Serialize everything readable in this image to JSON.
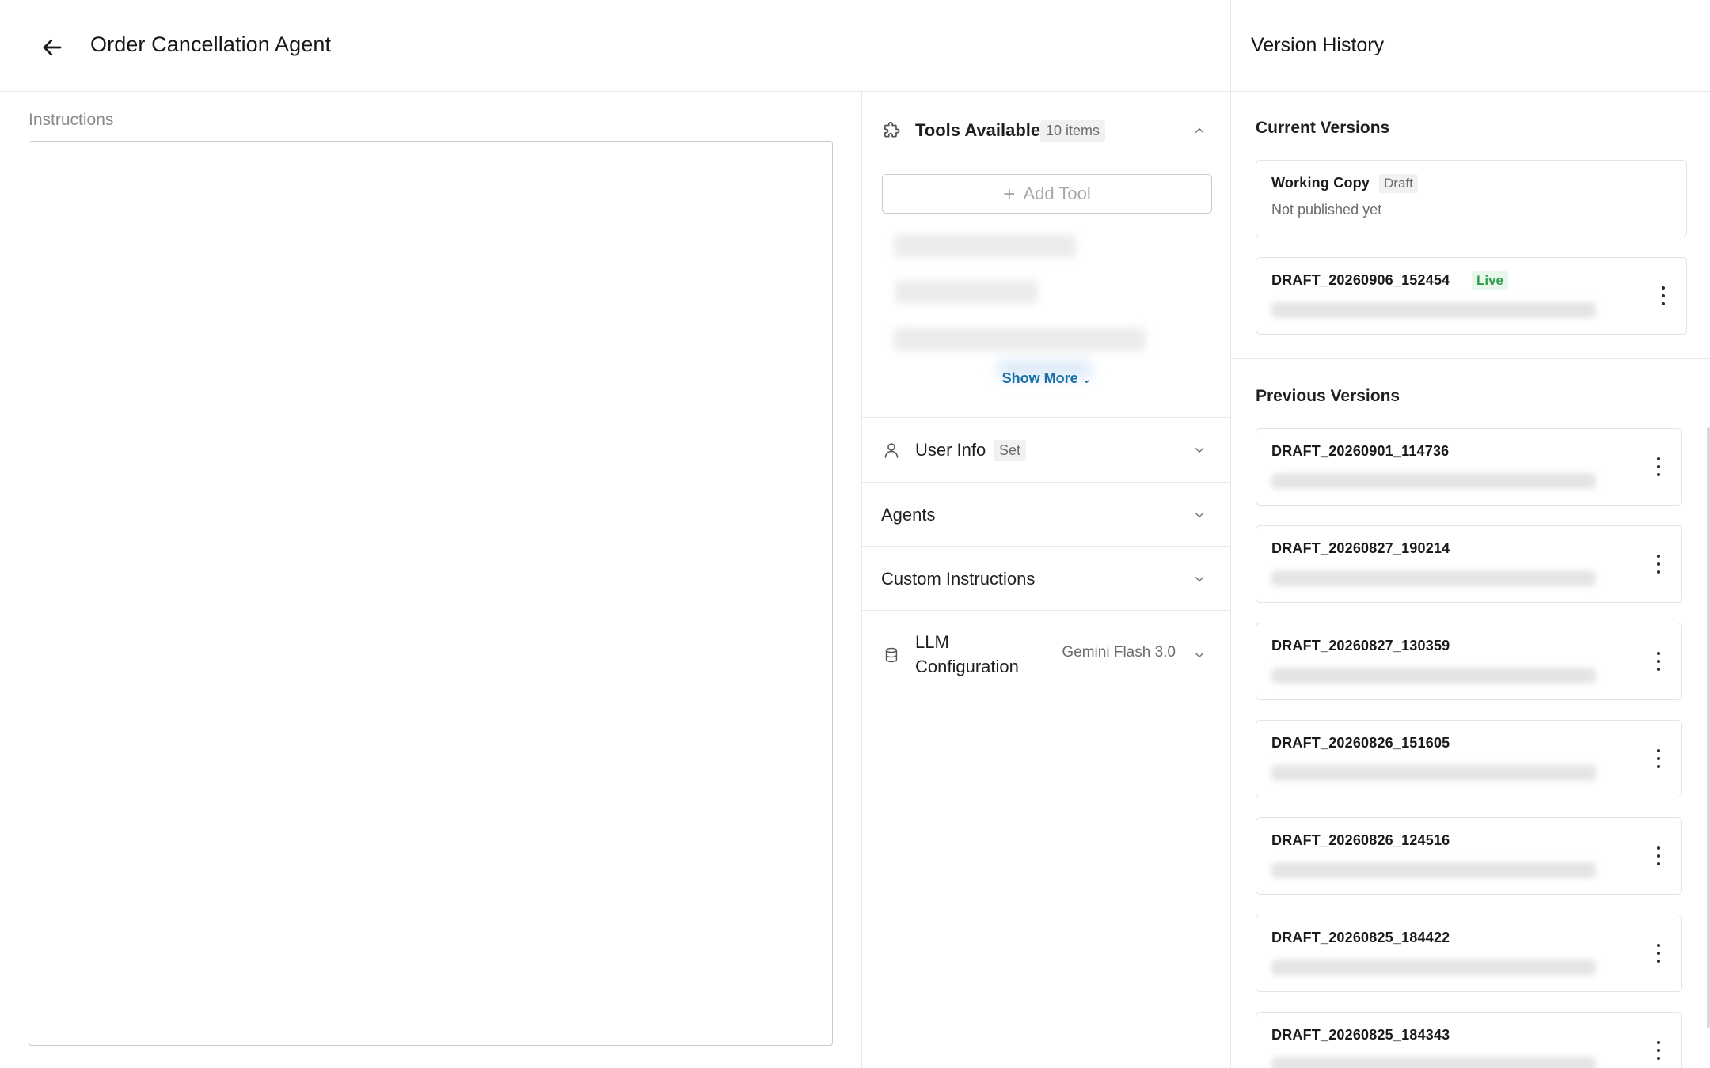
{
  "header": {
    "title": "Order Cancellation Agent",
    "back_icon": "arrow-left-icon"
  },
  "instructions": {
    "label": "Instructions",
    "value": ""
  },
  "config": {
    "tools": {
      "title": "Tools Available",
      "count_badge": "10 items",
      "icon": "puzzle-icon",
      "expanded": true,
      "add_label": "Add Tool",
      "show_more": "Show More",
      "show_more_chevron": "⌄"
    },
    "user_info": {
      "title": "User Info",
      "badge": "Set",
      "icon": "user-icon"
    },
    "agents": {
      "title": "Agents"
    },
    "custom_instructions": {
      "title": "Custom Instructions"
    },
    "llm": {
      "title": "LLM Configuration",
      "value": "Gemini Flash 3.0",
      "icon": "database-icon"
    }
  },
  "version_history": {
    "title": "Version History",
    "current_heading": "Current Versions",
    "previous_heading": "Previous Versions",
    "current": [
      {
        "name": "Working Copy",
        "badge": "Draft",
        "meta": "Not published yet"
      },
      {
        "name": "DRAFT_20260906_152454",
        "badge": "Live"
      }
    ],
    "previous": [
      {
        "name": "DRAFT_20260901_114736"
      },
      {
        "name": "DRAFT_20260827_190214"
      },
      {
        "name": "DRAFT_20260827_130359"
      },
      {
        "name": "DRAFT_20260826_151605"
      },
      {
        "name": "DRAFT_20260826_124516"
      },
      {
        "name": "DRAFT_20260825_184422"
      },
      {
        "name": "DRAFT_20260825_184343"
      }
    ]
  },
  "colors": {
    "live_badge": "#2e9d4e",
    "link": "#1a6fa8",
    "border": "#e7e7e7"
  }
}
